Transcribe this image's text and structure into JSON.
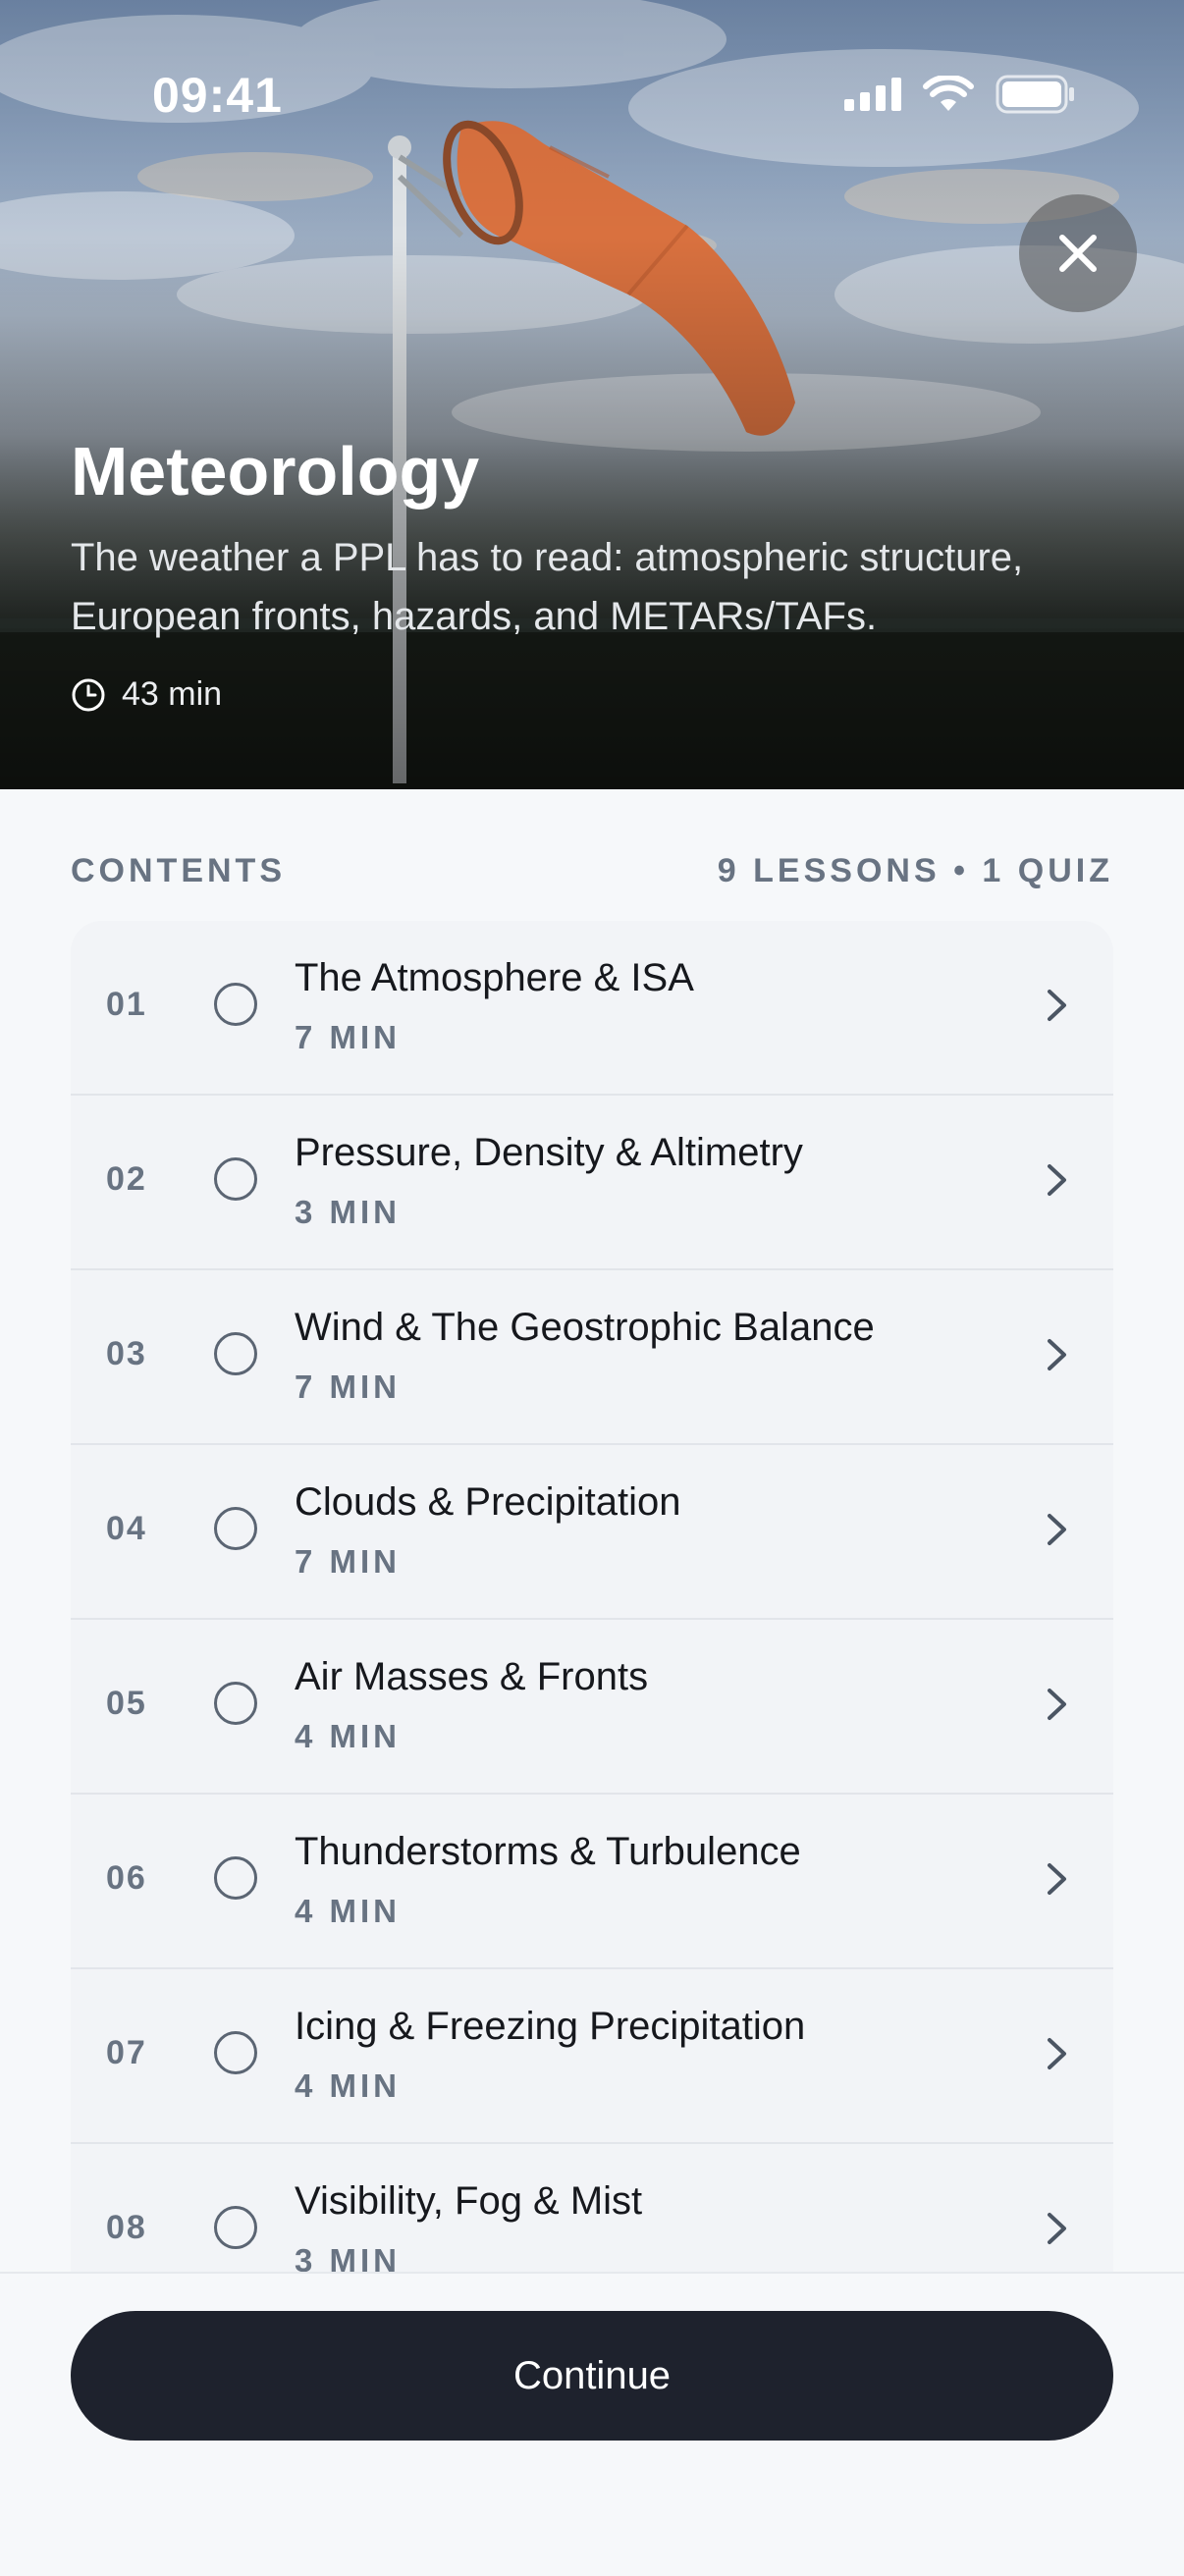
{
  "status_bar": {
    "time": "09:41"
  },
  "hero": {
    "title": "Meteorology",
    "description": "The weather a PPL has to read: atmospheric structure, European fronts, hazards, and METARs/TAFs.",
    "duration": "43 min"
  },
  "contents": {
    "heading": "CONTENTS",
    "summary": "9 LESSONS • 1 QUIZ",
    "lessons": [
      {
        "number": "01",
        "title": "The Atmosphere & ISA",
        "duration": "7 MIN"
      },
      {
        "number": "02",
        "title": "Pressure, Density & Altimetry",
        "duration": "3 MIN"
      },
      {
        "number": "03",
        "title": "Wind & The Geostrophic Balance",
        "duration": "7 MIN"
      },
      {
        "number": "04",
        "title": "Clouds & Precipitation",
        "duration": "7 MIN"
      },
      {
        "number": "05",
        "title": "Air Masses & Fronts",
        "duration": "4 MIN"
      },
      {
        "number": "06",
        "title": "Thunderstorms & Turbulence",
        "duration": "4 MIN"
      },
      {
        "number": "07",
        "title": "Icing & Freezing Precipitation",
        "duration": "4 MIN"
      },
      {
        "number": "08",
        "title": "Visibility, Fog & Mist",
        "duration": "3 MIN"
      }
    ]
  },
  "footer": {
    "continue_label": "Continue"
  },
  "colors": {
    "primary_button": "#1e222d",
    "muted_text": "#687382",
    "windsock": "#d9713f"
  },
  "icons": [
    "signal-icon",
    "wifi-icon",
    "battery-icon",
    "close-icon",
    "clock-icon",
    "radio-circle-icon",
    "chevron-right-icon"
  ]
}
